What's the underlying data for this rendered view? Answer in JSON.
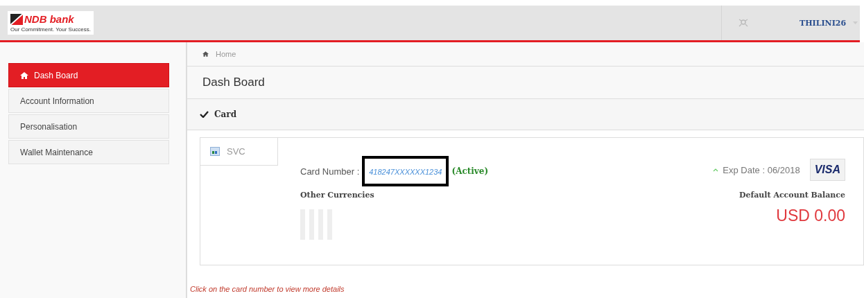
{
  "header": {
    "logo_name": "NDB bank",
    "logo_tagline": "Our Commitment. Your Success.",
    "username": "THILINI26"
  },
  "sidebar": {
    "items": [
      {
        "label": "Dash Board",
        "selected": true
      },
      {
        "label": "Account Information",
        "selected": false
      },
      {
        "label": "Personalisation",
        "selected": false
      },
      {
        "label": "Wallet Maintenance",
        "selected": false
      }
    ]
  },
  "breadcrumb": "Home",
  "page_title": "Dash Board",
  "section": {
    "title": "Card"
  },
  "card_tabs": [
    {
      "label": "SVC",
      "selected": true
    }
  ],
  "card": {
    "number_label": "Card Number :",
    "number": "418247XXXXXX1234",
    "highlighted": true,
    "status": "(Active)",
    "exp_date": "Exp Date : 06/2018",
    "brand": "VISA",
    "other_currencies_label": "Other Currencies",
    "balance_label": "Default Account Balance",
    "balance": "USD 0.00"
  },
  "hint": "Click on the card number to view more details"
}
